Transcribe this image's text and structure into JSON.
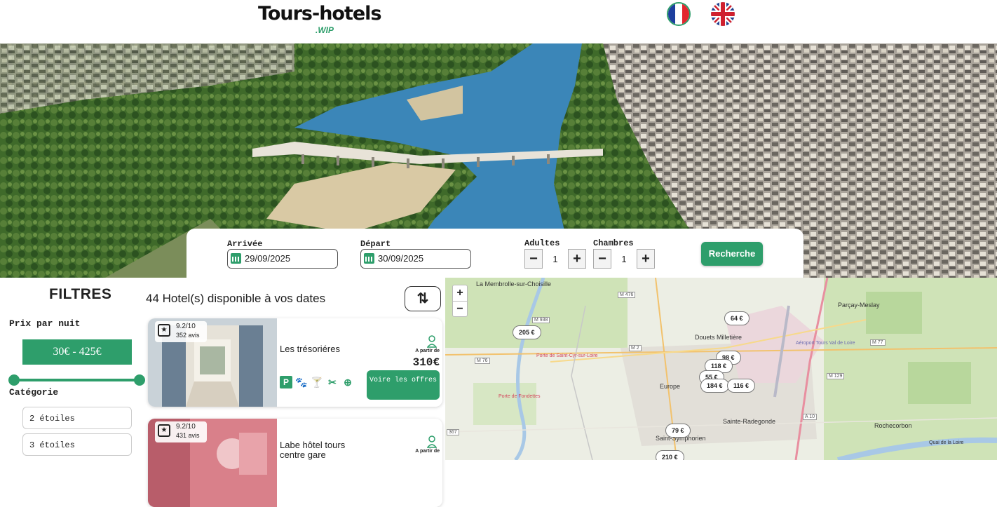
{
  "header": {
    "logo_main": "Tours-hotels",
    "logo_sub": ".WIP",
    "languages": [
      "fr-flag-icon",
      "uk-flag-icon"
    ]
  },
  "search": {
    "arrival_label": "Arrivée",
    "arrival_value": "29/09/2025",
    "departure_label": "Départ",
    "departure_value": "30/09/2025",
    "adults_label": "Adultes",
    "adults_value": "1",
    "rooms_label": "Chambres",
    "rooms_value": "1",
    "minus": "−",
    "plus": "+",
    "button": "Recherche"
  },
  "filters": {
    "title": "FILTRES",
    "price_label": "Prix par nuit",
    "price_range": "30€ - 425€",
    "category_label": "Catégorie",
    "categories": [
      "2 étoiles",
      "3 étoiles"
    ]
  },
  "results": {
    "count_text": "44 Hotel(s) disponible à vos dates",
    "sort_icon": "⇅",
    "hotels": [
      {
        "score": "9.2/10",
        "reviews": "352 avis",
        "name_lines": [
          "Les trésoriéres"
        ],
        "from_label": "A partir de",
        "price": "310€",
        "offers_label": "Voire les offres",
        "amenities": [
          "P",
          "🐾",
          "🍸",
          "✂",
          "⊕"
        ]
      },
      {
        "score": "9.2/10",
        "reviews": "431 avis",
        "name_lines": [
          "Labe hôtel tours",
          "centre gare"
        ],
        "from_label": "A partir de"
      }
    ]
  },
  "map": {
    "zoom_in": "+",
    "zoom_out": "−",
    "markers": [
      "64 €",
      "205 €",
      "98 €",
      "118 €",
      "55 €",
      "184 €",
      "116 €",
      "79 €",
      "210 €"
    ],
    "places": [
      "La Membrolle-sur-Choisille",
      "Parçay-Meslay",
      "Douets Milletière",
      "Europe",
      "Sainte-Radegonde",
      "Rochecorbon",
      "Saint-Symphorien",
      "Porte de Saint-Cyr-sur-Loire",
      "Porte de Fondettes",
      "Aéroport Tours Val de Loire"
    ],
    "roads": [
      "M 476",
      "M 938",
      "M 2",
      "M 76",
      "M 77",
      "M 129",
      "A 10",
      "367",
      "Quai de la Loire"
    ]
  },
  "colors": {
    "accent": "#2e9e6b"
  }
}
